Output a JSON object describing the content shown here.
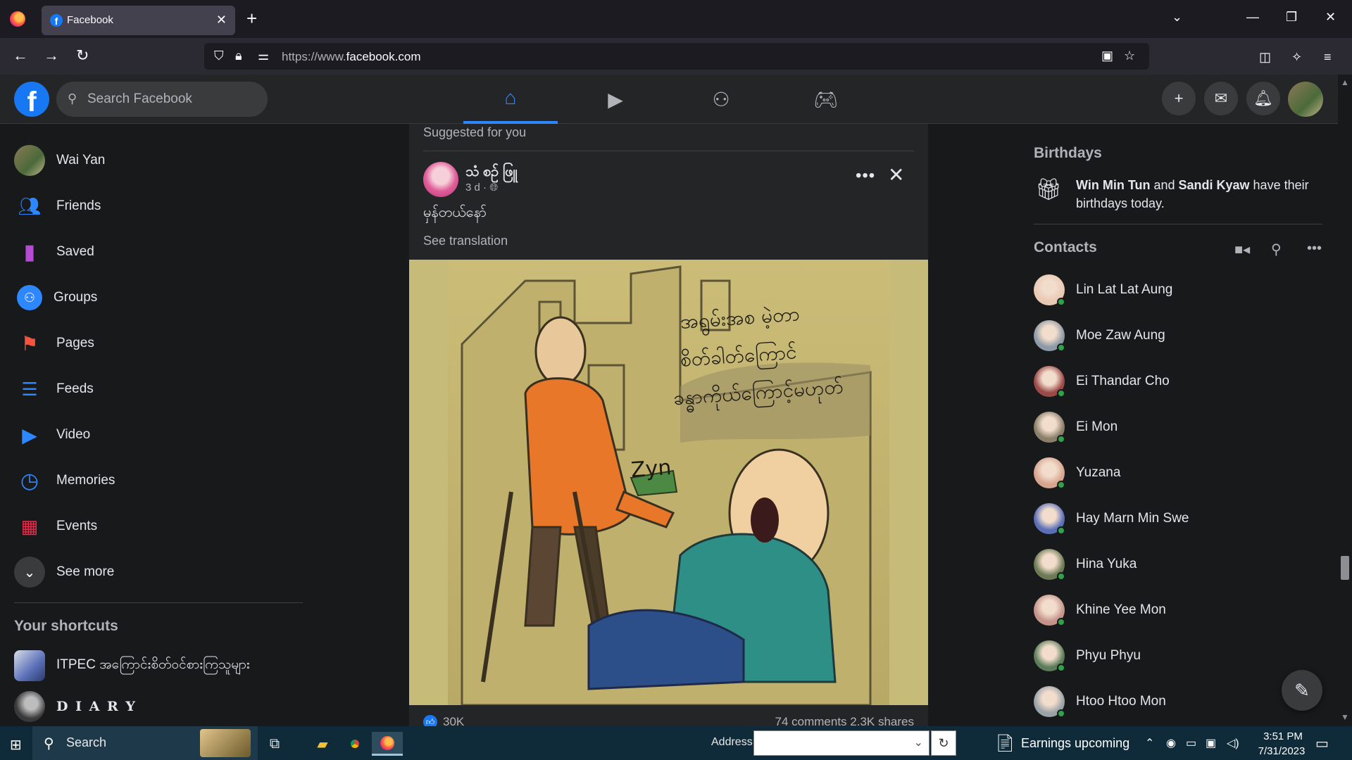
{
  "browser": {
    "tab_title": "Facebook",
    "url_scheme": "https://www.",
    "url_domain": "facebook.com"
  },
  "header": {
    "logo": "f",
    "search_placeholder": "Search Facebook"
  },
  "sidebar": {
    "user": "Wai Yan",
    "items": [
      {
        "label": "Friends",
        "icon": "friends-icon",
        "color": "#2d88ff"
      },
      {
        "label": "Saved",
        "icon": "bookmark-icon",
        "color": "#b84ad6"
      },
      {
        "label": "Groups",
        "icon": "groups-icon",
        "color": "#2d88ff"
      },
      {
        "label": "Pages",
        "icon": "flag-icon",
        "color": "#f5533d"
      },
      {
        "label": "Feeds",
        "icon": "feeds-icon",
        "color": "#2d88ff"
      },
      {
        "label": "Video",
        "icon": "video-icon",
        "color": "#2d88ff"
      },
      {
        "label": "Memories",
        "icon": "clock-icon",
        "color": "#2d88ff"
      },
      {
        "label": "Events",
        "icon": "calendar-icon",
        "color": "#f02849"
      },
      {
        "label": "See more",
        "icon": "chevron-down-icon",
        "color": "#3a3b3c"
      }
    ],
    "shortcuts_title": "Your shortcuts",
    "shortcuts": [
      {
        "label": "ITPEC အကြောင်းစိတ်ဝင်စားကြသူများ"
      },
      {
        "label": "D I A R Y"
      }
    ]
  },
  "feed": {
    "suggested_label": "Suggested for you",
    "post": {
      "author": "သံ စဉ် ဖြူ",
      "time": "3 d ·",
      "text": "မှန်တယ်နော်",
      "see_translation": "See translation",
      "image_text": {
        "line1": "အရွမ်းအစ မဲ့တာ",
        "line2": "စိတ်ခါတ်ကြောင်",
        "line3": "ခန္ဓာကိုယ်ကြောင့်မဟုတ်",
        "signature": "Zyn"
      },
      "likes": "30K",
      "comments_shares": "74 comments   2.3K shares"
    }
  },
  "rightbar": {
    "birthdays_title": "Birthdays",
    "birthday_name1": "Win Min Tun",
    "birthday_and": " and ",
    "birthday_name2": "Sandi Kyaw",
    "birthday_suffix": " have their birthdays today.",
    "contacts_title": "Contacts",
    "contacts": [
      {
        "name": "Lin Lat Lat Aung",
        "color": "#e9c9b4"
      },
      {
        "name": "Moe Zaw Aung",
        "color": "#8e9aa8"
      },
      {
        "name": "Ei Thandar Cho",
        "color": "#9b4a4a"
      },
      {
        "name": "Ei Mon",
        "color": "#8a7f6a"
      },
      {
        "name": "Yuzana",
        "color": "#d7a58f"
      },
      {
        "name": "Hay Marn Min Swe",
        "color": "#5a6fb8"
      },
      {
        "name": "Hina Yuka",
        "color": "#6c7a55"
      },
      {
        "name": "Khine Yee Mon",
        "color": "#c4948a"
      },
      {
        "name": "Phyu Phyu",
        "color": "#5b7d5a"
      },
      {
        "name": "Htoo Htoo Mon",
        "color": "#9aa3a8"
      }
    ]
  },
  "taskbar": {
    "search_label": "Search",
    "address_label": "Address",
    "address_value": "",
    "weather_text": "Earnings upcoming",
    "time": "3:51 PM",
    "date": "7/31/2023"
  }
}
